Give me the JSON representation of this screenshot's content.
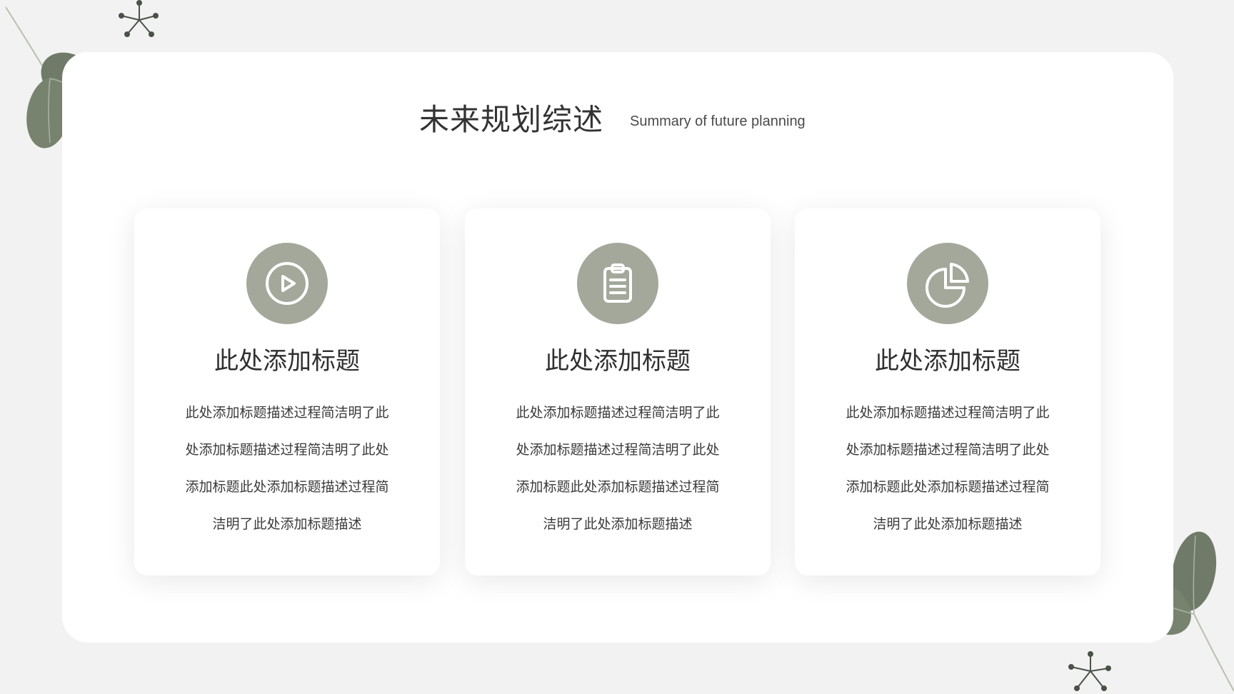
{
  "header": {
    "title": "未来规划综述",
    "subtitle": "Summary of future planning"
  },
  "cards": [
    {
      "icon": "play-circle-icon",
      "title": "此处添加标题",
      "lines": [
        "此处添加标题描述过程简洁明了此",
        "处添加标题描述过程简洁明了此处",
        "添加标题此处添加标题描述过程简",
        "洁明了此处添加标题描述"
      ]
    },
    {
      "icon": "clipboard-icon",
      "title": "此处添加标题",
      "lines": [
        "此处添加标题描述过程简洁明了此",
        "处添加标题描述过程简洁明了此处",
        "添加标题此处添加标题描述过程简",
        "洁明了此处添加标题描述"
      ]
    },
    {
      "icon": "pie-chart-icon",
      "title": "此处添加标题",
      "lines": [
        "此处添加标题描述过程简洁明了此",
        "处添加标题描述过程简洁明了此处",
        "添加标题此处添加标题描述过程简",
        "洁明了此处添加标题描述"
      ]
    }
  ],
  "colors": {
    "background": "#f2f2f2",
    "panel": "#ffffff",
    "icon_circle": "#a3a89b",
    "leaf": "#6f7b68"
  }
}
